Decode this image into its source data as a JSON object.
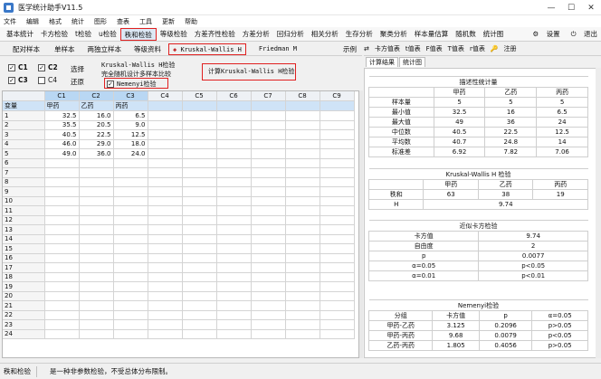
{
  "window": {
    "title": "医学统计助手V11.5",
    "minimize": "—",
    "maximize": "☐",
    "close": "✕"
  },
  "menu": [
    "文件",
    "编辑",
    "格式",
    "统计",
    "图形",
    "查表",
    "工具",
    "更新",
    "帮助"
  ],
  "tabs": [
    "基本统计",
    "卡方检验",
    "t检验",
    "u检验",
    "秩和检验",
    "等级检验",
    "方差齐性检验",
    "方差分析",
    "回归分析",
    "相关分析",
    "生存分析",
    "聚类分析",
    "样本量估算",
    "随机数",
    "统计图"
  ],
  "active_tab": "秩和检验",
  "tab_right": {
    "settings": "设置",
    "exit": "退出"
  },
  "subtabs": [
    "配对样本",
    "单样本",
    "两独立样本",
    "等级资料",
    "Kruskal-Wallis H",
    "Friedman M"
  ],
  "example_label": "示例",
  "controls": {
    "c1": "C1",
    "c2": "C2",
    "c3": "C3",
    "c4": "C4",
    "select": "选择",
    "restore": "还原",
    "desc_line1": "Kruskal-Wallis H检验",
    "desc_line2": "完全随机设计多样本比较",
    "nemenyi": "Nemenyi检验",
    "calc_button": "计算Kruskal-Wallis H检验"
  },
  "grid": {
    "columns": [
      "C1",
      "C2",
      "C3",
      "C4",
      "C5",
      "C6",
      "C7",
      "C8",
      "C9"
    ],
    "row_label": "变量",
    "header_values": [
      "甲药",
      "乙药",
      "丙药"
    ],
    "rows": [
      [
        "32.5",
        "16.0",
        "6.5"
      ],
      [
        "35.5",
        "20.5",
        "9.0"
      ],
      [
        "40.5",
        "22.5",
        "12.5"
      ],
      [
        "46.0",
        "29.0",
        "18.0"
      ],
      [
        "49.0",
        "36.0",
        "24.0"
      ]
    ],
    "row_count": 24
  },
  "right_panel": {
    "tabs": [
      "卡方值表",
      "t值表",
      "F值表",
      "T值表",
      "r值表",
      "注册"
    ],
    "subtabs": [
      "计算结果",
      "统计图"
    ],
    "desc": {
      "caption": "描述性统计量",
      "headers": [
        "",
        "甲药",
        "乙药",
        "丙药"
      ],
      "rows": [
        [
          "样本量",
          "5",
          "5",
          "5"
        ],
        [
          "最小值",
          "32.5",
          "16",
          "6.5"
        ],
        [
          "最大值",
          "49",
          "36",
          "24"
        ],
        [
          "中位数",
          "40.5",
          "22.5",
          "12.5"
        ],
        [
          "平均数",
          "40.7",
          "24.8",
          "14"
        ],
        [
          "标准差",
          "6.92",
          "7.82",
          "7.06"
        ]
      ]
    },
    "kw": {
      "caption": "Kruskal-Wallis H 检验",
      "headers": [
        "",
        "甲药",
        "乙药",
        "丙药"
      ],
      "rows": [
        [
          "秩和",
          "63",
          "38",
          "19"
        ]
      ],
      "h_label": "H",
      "h_value": "9.74"
    },
    "chi": {
      "caption": "近似卡方检验",
      "rows": [
        [
          "卡方值",
          "9.74"
        ],
        [
          "自由度",
          "2"
        ],
        [
          "p",
          "0.0077"
        ],
        [
          "α=0.05",
          "p<0.05"
        ],
        [
          "α=0.01",
          "p<0.01"
        ]
      ]
    },
    "nemenyi": {
      "caption": "Nemenyi检验",
      "headers": [
        "分组",
        "卡方值",
        "p",
        "α=0.05"
      ],
      "rows": [
        [
          "甲药-乙药",
          "3.125",
          "0.2096",
          "p>0.05"
        ],
        [
          "甲药-丙药",
          "9.68",
          "0.0079",
          "p<0.05"
        ],
        [
          "乙药-丙药",
          "1.805",
          "0.4056",
          "p>0.05"
        ]
      ]
    }
  },
  "status": {
    "left": "秩和检验",
    "message": "是一种非参数检验，不受总体分布限制。"
  }
}
